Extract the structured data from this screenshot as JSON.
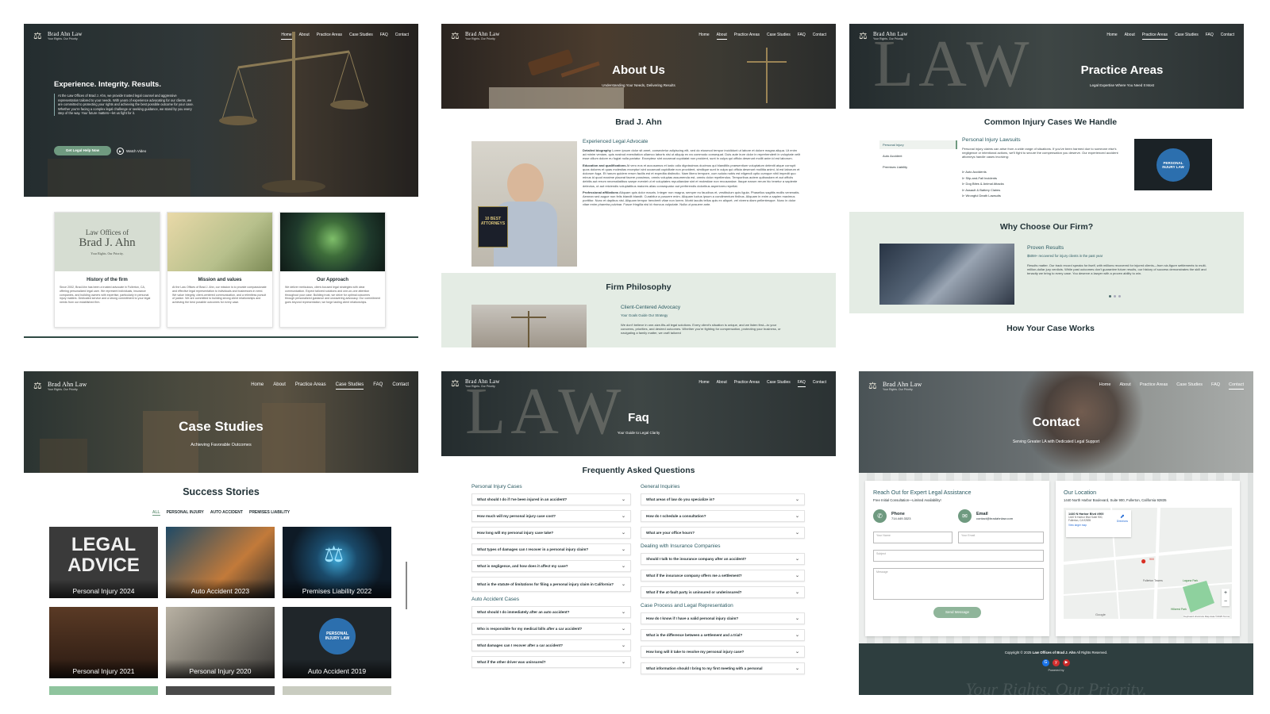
{
  "brand": {
    "name": "Brad Ahn Law",
    "tagline": "Your Rights. Our Priority."
  },
  "nav": {
    "home": "Home",
    "about": "About",
    "practice": "Practice Areas",
    "cases": "Case Studies",
    "faq": "FAQ",
    "contact": "Contact"
  },
  "home": {
    "headline": "Experience. Integrity. Results.",
    "intro": "At the Law Offices of Brad J. Ahn, we provide trusted legal counsel and aggressive representation tailored to your needs. With years of experience advocating for our clients, we are committed to protecting your rights and achieving the best possible outcome for your case. Whether you're facing a complex legal challenge or seeking guidance, we stand by you every step of the way. Your future matters—let us fight for it.",
    "cta": "Get Legal Help Now",
    "video": "Watch Video",
    "card_logo": {
      "line1": "Law Offices of",
      "line2": "Brad J. Ahn",
      "line3": "Your Rights. Our Priority."
    },
    "cards": [
      {
        "title": "History of the firm",
        "body": "Since 2002, Brad Ahn has been a trusted advocate in Fullerton, CA, offering personalized legal care. We represent individuals, insurance companies, and building owners with expertise, particularly in personal injury matters. Dedicated service and a strong commitment to your legal needs from our established firm."
      },
      {
        "title": "Mission and values",
        "body": "At the Law Offices of Brad J. Ahn, our mission is to provide compassionate and effective legal representation to individuals and businesses in need. We value integrity, client-centered communication, and a relentless pursuit of justice. We are committed to building strong client relationships and achieving the best possible outcomes for every case."
      },
      {
        "title": "Our Approach",
        "body": "We deliver meticulous, client-focused legal strategies with clear communication. Expect tailored solutions and one-on-one attention throughout your case. Building trust, we strive for optimal outcomes through personalized guidance and unwavering advocacy. Our commitment goes beyond representation; we forge lasting client relationships."
      }
    ]
  },
  "about": {
    "title": "About Us",
    "subtitle": "Understanding Your Needs, Delivering Results",
    "name": "Brad J. Ahn",
    "role": "Experienced Legal Advocate",
    "plaque": "10 BEST ATTORNEYS",
    "bio": [
      {
        "label": "Detailed biography",
        "text": "Lorem ipsum dolor sit amet, consectetur adipiscing elit, sed do eiusmod tempor incididunt ut labore et dolore magna aliqua. Ut enim ad minim veniam, quis nostrud exercitation ullamco laboris nisi ut aliquip ex ea commodo consequat. Duis aute irure dolor in reprehenderit in voluptate velit esse cillum dolore eu fugiat nulla pariatur. Excepteur sint occaecat cupidatat non proident, sunt in culpa qui officia deserunt mollit anim id est laborum."
      },
      {
        "label": "Education and qualifications",
        "text": "At vero eos et accusamus et iusto odio dignissimos ducimus qui blanditiis praesentium voluptatum deleniti atque corrupti quos dolores et quas molestias excepturi sint occaecati cupiditate non provident, similique sunt in culpa qui officia deserunt mollitia animi, id est laborum et dolorum fuga. Et harum quidem rerum facilis est et expedita distinctio. Nam libero tempore, cum soluta nobis est eligendi optio cumque nihil impedit quo minus id quod maxime placeat facere possimus, omnis voluptas assumenda est, omnis dolor repellendus. Temporibus autem quibusdam et aut officiis debitis aut rerum necessitatibus saepe eveniet ut et voluptates repudiandae sint et molestiae non recusandae. Itaque earum rerum hic tenetur a sapiente delectus, ut aut reiciendis voluptatibus maiores alias consequatur aut perferendis doloribus asperiores repellat."
      },
      {
        "label": "Professional affiliations",
        "text": "Aliquam quis dolor mauris. Integer non magna, semper eu faucibus et, vestibulum quis ligula. Phasellus sagittis mollis venenatis. Aenean sed augue non felis blandit blandit. Curabitur a posuere enim. Aliquam luctus ipsum a condimentum finibus. Aliquam in enim a sapien maximus porttitor. Nunc et dapibus nisl. Aliquam tempor hendrerit vitae non lorem. Morbi iaculis tellus quis ex aliquet, vel viverra diam pellentesque. Nunc in dolor vitae enim pharetra pulvinar. Fusce fringilla nisi id rhoncus vulputate. Nulla ut posuere ante."
      }
    ],
    "philosophy_title": "Firm Philosophy",
    "philosophy_heading": "Client-Centered Advocacy",
    "philosophy_sub": "Your Goals Guide Our Strategy",
    "philosophy_text": "We don't believe in one-size-fits-all legal solutions. Every client's situation is unique, and we listen first—to your concerns, priorities, and desired outcomes. Whether you're fighting for compensation, protecting your business, or navigating a family matter, we craft tailored"
  },
  "practice": {
    "title": "Practice Areas",
    "subtitle": "Legal Expertise Where You Need It Most",
    "section": "Common Injury Cases We Handle",
    "tabs": [
      "Personal Injury",
      "Auto Accident",
      "Premises Liability"
    ],
    "pi_title": "Personal Injury Lawsuits",
    "pi_text": "Personal injury claims can arise from a wide range of situations. If you've been harmed due to someone else's negligence or intentional actions, we'll fight to secure the compensation you deserve. Our experienced accident attorneys handle cases involving:",
    "pi_list": [
      "Auto Accidents",
      "Slip-and-Fall Incidents",
      "Dog Bites & Animal Attacks",
      "Assault & Battery Claims",
      "Wrongful Death Lawsuits"
    ],
    "badge": "PERSONAL INJURY LAW",
    "why_title": "Why Choose Our Firm?",
    "proven": "Proven Results",
    "proven_sub": "$50M+ recovered for injury clients in the past year",
    "proven_text": "Results matter. Our track record speaks for itself, with millions recovered for injured clients—from six-figure settlements to multi-million-dollar jury verdicts. While past outcomes don't guarantee future results, our history of success demonstrates the skill and tenacity we bring to every case. You deserve a lawyer with a proven ability to win.",
    "how_title": "How Your Case Works"
  },
  "cases": {
    "title": "Case Studies",
    "subtitle": "Achieving Favorable Outcomes",
    "section": "Success Stories",
    "filters": [
      "ALL",
      "PERSONAL INJURY",
      "AUTO ACCIDENT",
      "PREMISES LIABILITY"
    ],
    "legal_advice": [
      "LEGAL",
      "ADVICE"
    ],
    "tiles": [
      "Personal Injury 2024",
      "Auto Accident 2023",
      "Premises Liability 2022",
      "Personal Injury 2021",
      "Personal Injury 2020",
      "Auto Accident 2019"
    ],
    "tile_badge": "PERSONAL INJURY LAW"
  },
  "faq": {
    "title": "Faq",
    "subtitle": "Your Guide to Legal Clarity",
    "section": "Frequently Asked Questions",
    "left": [
      {
        "cat": "Personal Injury Cases",
        "qs": [
          "What should I do if I've been injured in an accident?",
          "How much will my personal injury case cost?",
          "How long will my personal injury case take?",
          "What types of damages can I recover in a personal injury claim?",
          "What is negligence, and how does it affect my case?",
          "What is the statute of limitations for filing a personal injury claim in California?"
        ]
      },
      {
        "cat": "Auto Accident Cases",
        "qs": [
          "What should I do immediately after an auto accident?",
          "Who is responsible for my medical bills after a car accident?",
          "What damages can I recover after a car accident?",
          "What if the other driver was uninsured?"
        ]
      }
    ],
    "right": [
      {
        "cat": "General Inquiries",
        "qs": [
          "What areas of law do you specialize in?",
          "How do I schedule a consultation?",
          "What are your office hours?"
        ]
      },
      {
        "cat": "Dealing with Insurance Companies",
        "qs": [
          "Should I talk to the insurance company after an accident?",
          "What if the insurance company offers me a settlement?",
          "What if the at-fault party is uninsured or underinsured?"
        ]
      },
      {
        "cat": "Case Process and Legal Representation",
        "qs": [
          "How do I know if I have a valid personal injury claim?",
          "What is the difference between a settlement and a trial?",
          "How long will it take to resolve my personal injury case?",
          "What information should I bring to my first meeting with a personal"
        ]
      }
    ]
  },
  "contact": {
    "title": "Contact",
    "subtitle": "Serving Greater LA with Dedicated Legal Support",
    "reach": "Reach Out for Expert Legal Assistance",
    "free": "Free Initial Consultation—Limited Availability!",
    "phone_label": "Phone",
    "phone": "714.449.3323",
    "email_label": "Email",
    "email": "contact@bradahnlaw.com",
    "ph_name": "Your Name",
    "ph_email": "Your Email",
    "ph_subject": "Subject",
    "ph_message": "Message",
    "send": "Send Message",
    "loc_title": "Our Location",
    "address": "1440 North Harbor Boulevard, Suite 900, Fullerton, California 92835",
    "map_card": "1440 N Harbor Blvd #900",
    "map_card2": "1440 N Harbor Blvd Suite 900, Fullerton, CA 92835",
    "directions": "Directions",
    "larger_map": "View larger map",
    "map_labels": [
      "Fullerton Towers",
      "Laguna Park",
      "Hillcrest Park"
    ],
    "map_pin": "900",
    "map_footer": "Keyboard shortcuts   Map data ©2025   Terms",
    "google": "Google",
    "copyright": "Copyright © 2025",
    "copyright_firm": "Law Offices of Brad J. Ahn",
    "rights": "All Rights Reserved.",
    "powered": "Powered by",
    "footer_script": "Your Rights, Our Priority."
  },
  "colors": {
    "dark": "#243236",
    "accent": "#6f9a80",
    "mint": "#e4ece4",
    "teal": "#2c5b63"
  }
}
